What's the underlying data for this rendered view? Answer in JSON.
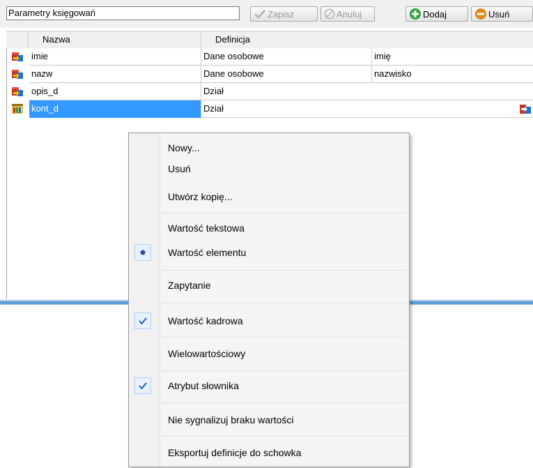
{
  "toolbar": {
    "title_field": "Parametry księgowań",
    "save_label": "Zapisz",
    "cancel_label": "Anuluj",
    "add_label": "Dodaj",
    "delete_label": "Usuń"
  },
  "grid": {
    "columns": [
      "Nazwa",
      "Definicja"
    ],
    "rows": [
      {
        "name": "imie",
        "definition": "Dane osobowe",
        "value": "imię",
        "icon": "red-param-icon"
      },
      {
        "name": "nazw",
        "definition": "Dane osobowe",
        "value": "nazwisko",
        "icon": "red-param-icon"
      },
      {
        "name": "opis_d",
        "definition": "Dział",
        "value": "",
        "icon": "red-param-icon"
      },
      {
        "name": "kont_d",
        "definition": "Dział",
        "value": "",
        "icon": "multi-param-icon",
        "selected": true
      }
    ]
  },
  "context_menu": {
    "items": [
      {
        "label": "Nowy...",
        "mark": ""
      },
      {
        "label": "Usuń",
        "mark": ""
      },
      {
        "label": "Utwórz kopię...",
        "mark": ""
      },
      {
        "label": "Wartość tekstowa",
        "mark": ""
      },
      {
        "label": "Wartość elementu",
        "mark": "radio"
      },
      {
        "label": "Zapytanie",
        "mark": ""
      },
      {
        "label": "Wartość kadrowa",
        "mark": "check"
      },
      {
        "label": "Wielowartościowy",
        "mark": ""
      },
      {
        "label": "Atrybut słownika",
        "mark": "check"
      },
      {
        "label": "Nie sygnalizuj braku wartości",
        "mark": ""
      },
      {
        "label": "Eksportuj definicje do schowka",
        "mark": ""
      }
    ]
  },
  "colors": {
    "selection": "#3399ff",
    "divider": "#4a8ed0",
    "check_mark": "#1f5fbf"
  }
}
